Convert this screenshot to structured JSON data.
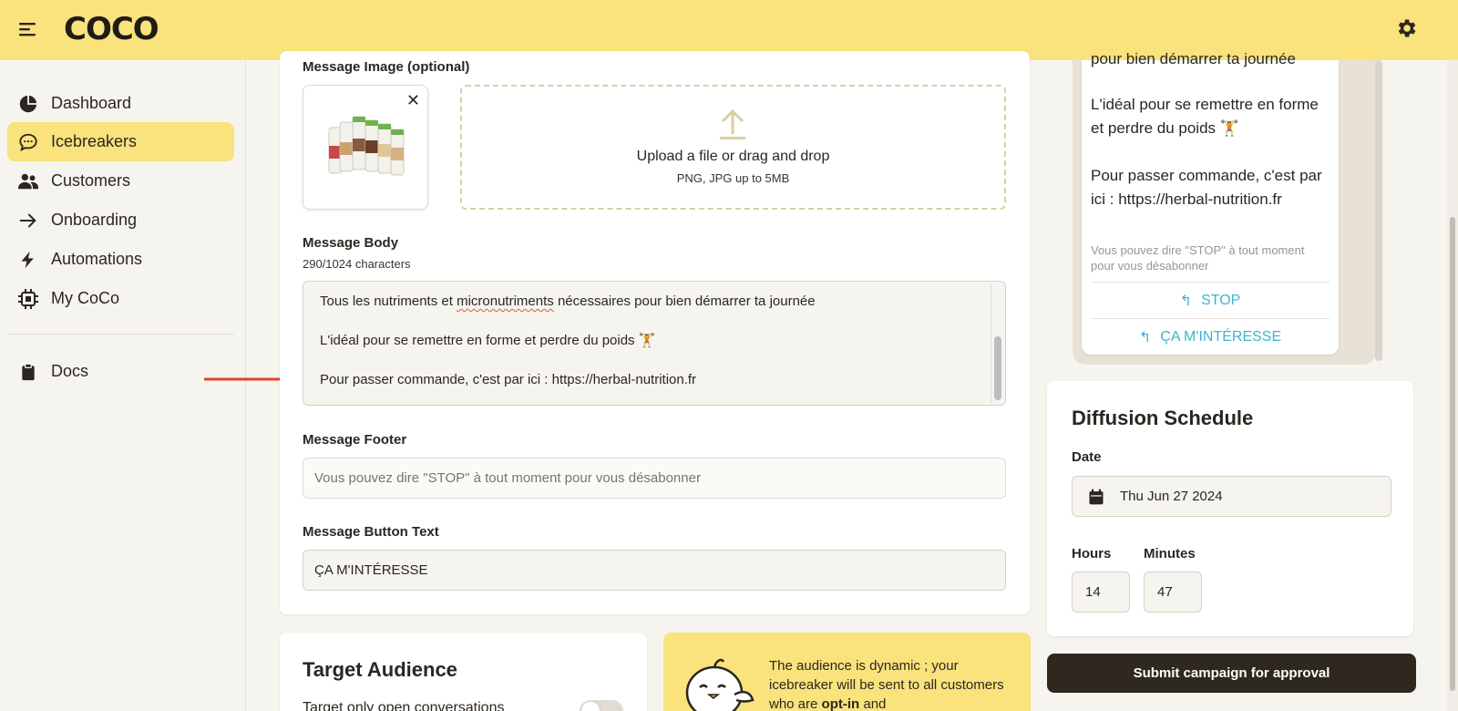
{
  "app": {
    "logo": "COCO"
  },
  "sidebar": {
    "items": [
      {
        "label": "Dashboard",
        "icon": "pie-chart-icon"
      },
      {
        "label": "Icebreakers",
        "icon": "chat-bubble-icon",
        "active": true
      },
      {
        "label": "Customers",
        "icon": "users-icon"
      },
      {
        "label": "Onboarding",
        "icon": "arrow-right-icon"
      },
      {
        "label": "Automations",
        "icon": "lightning-icon"
      },
      {
        "label": "My CoCo",
        "icon": "chip-icon"
      },
      {
        "label": "Docs",
        "icon": "clipboard-icon"
      }
    ]
  },
  "form": {
    "image_label": "Message Image (optional)",
    "upload_title": "Upload a file or drag and drop",
    "upload_sub": "PNG, JPG up to 5MB",
    "body_label": "Message Body",
    "body_count": "290/1024 characters",
    "body_lines": [
      "Tous les nutriments et micronutriments nécessaires pour bien démarrer ta journée",
      "L'idéal pour se remettre en forme et perdre du poids 🏋️",
      "Pour passer commande, c'est par ici : https://herbal-nutrition.fr"
    ],
    "body_line1_pre": "Tous les nutriments et ",
    "body_line1_word": "micronutriments",
    "body_line1_post": " nécessaires pour bien démarrer ta journée",
    "footer_label": "Message Footer",
    "footer_placeholder": "Vous pouvez dire \"STOP\" à tout moment pour vous désabonner",
    "button_label": "Message Button Text",
    "button_value": "ÇA M'INTÉRESSE"
  },
  "preview": {
    "line0": "pour bien démarrer ta journée",
    "line1": "L'idéal pour se remettre en forme et perdre du poids 🏋️",
    "line2": "Pour passer commande, c'est par ici : https://herbal-nutrition.fr",
    "footer": "Vous pouvez dire \"STOP\" à tout moment pour vous désabonner",
    "buttons": [
      "STOP",
      "ÇA M'INTÉRESSE"
    ]
  },
  "schedule": {
    "title": "Diffusion Schedule",
    "date_label": "Date",
    "date_value": "Thu Jun 27 2024",
    "hours_label": "Hours",
    "hours_value": "14",
    "minutes_label": "Minutes",
    "minutes_value": "47"
  },
  "submit_label": "Submit campaign for approval",
  "audience": {
    "title": "Target Audience",
    "toggle_label": "Target only open conversations",
    "toggle_on": false,
    "info_pre": "The audience is dynamic ; your icebreaker will be sent to all customers who are ",
    "info_bold": "opt-in",
    "info_post": " and"
  },
  "colors": {
    "accent": "#fae27c",
    "dark": "#2e281e",
    "link": "#3fb4c9",
    "annotation_arrow": "#e8402a"
  }
}
